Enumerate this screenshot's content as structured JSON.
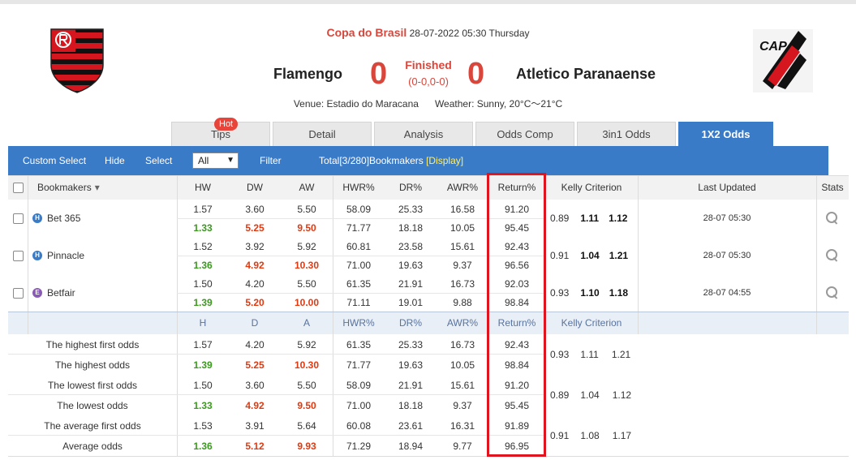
{
  "match": {
    "competition": "Copa do Brasil",
    "datetime": "28-07-2022 05:30 Thursday",
    "home_team": "Flamengo",
    "away_team": "Atletico Paranaense",
    "home_score": "0",
    "away_score": "0",
    "status": "Finished",
    "half_time": "(0-0,0-0)",
    "venue": "Venue: Estadio do Maracana",
    "weather": "Weather: Sunny, 20°C～21°C",
    "away_logo_text": "CAP"
  },
  "tabs": [
    {
      "label": "Tips",
      "badge": "Hot"
    },
    {
      "label": "Detail"
    },
    {
      "label": "Analysis"
    },
    {
      "label": "Odds Comp"
    },
    {
      "label": "3in1 Odds"
    },
    {
      "label": "1X2 Odds",
      "active": true
    }
  ],
  "toolbar": {
    "custom_select": "Custom Select",
    "hide": "Hide",
    "select": "Select",
    "dropdown_value": "All",
    "filter": "Filter",
    "total": "Total[3/280]Bookmakers",
    "display": "[Display]"
  },
  "headers": {
    "bookmakers": "Bookmakers",
    "hw": "HW",
    "dw": "DW",
    "aw": "AW",
    "hwr": "HWR%",
    "dr": "DR%",
    "awr": "AWR%",
    "ret": "Return%",
    "kelly": "Kelly Criterion",
    "updated": "Last Updated",
    "stats": "Stats"
  },
  "bookmakers": [
    {
      "name": "Bet 365",
      "icon_letter": "H",
      "icon_color": "#3a7bc8",
      "first": {
        "h": "1.57",
        "d": "3.60",
        "a": "5.50",
        "hwr": "58.09",
        "dr": "25.33",
        "awr": "16.58",
        "ret": "91.20"
      },
      "live": {
        "h": "1.33",
        "d": "5.25",
        "a": "9.50",
        "hwr": "71.77",
        "dr": "18.18",
        "awr": "10.05",
        "ret": "95.45"
      },
      "kelly": [
        "0.89",
        "1.11",
        "1.12"
      ],
      "updated": "28-07 05:30"
    },
    {
      "name": "Pinnacle",
      "icon_letter": "H",
      "icon_color": "#3a7bc8",
      "first": {
        "h": "1.52",
        "d": "3.92",
        "a": "5.92",
        "hwr": "60.81",
        "dr": "23.58",
        "awr": "15.61",
        "ret": "92.43"
      },
      "live": {
        "h": "1.36",
        "d": "4.92",
        "a": "10.30",
        "hwr": "71.00",
        "dr": "19.63",
        "awr": "9.37",
        "ret": "96.56"
      },
      "kelly": [
        "0.91",
        "1.04",
        "1.21"
      ],
      "updated": "28-07 05:30"
    },
    {
      "name": "Betfair",
      "icon_letter": "E",
      "icon_color": "#8a5bb5",
      "first": {
        "h": "1.50",
        "d": "4.20",
        "a": "5.50",
        "hwr": "61.35",
        "dr": "21.91",
        "awr": "16.73",
        "ret": "92.03"
      },
      "live": {
        "h": "1.39",
        "d": "5.20",
        "a": "10.00",
        "hwr": "71.11",
        "dr": "19.01",
        "awr": "9.88",
        "ret": "98.84"
      },
      "kelly": [
        "0.93",
        "1.10",
        "1.18"
      ],
      "updated": "28-07 04:55"
    }
  ],
  "summary_headers": {
    "h": "H",
    "d": "D",
    "a": "A",
    "hwr": "HWR%",
    "dr": "DR%",
    "awr": "AWR%",
    "ret": "Return%",
    "kelly": "Kelly Criterion"
  },
  "summary": [
    {
      "first_label": "The highest first odds",
      "first": {
        "h": "1.57",
        "d": "4.20",
        "a": "5.92",
        "hwr": "61.35",
        "dr": "25.33",
        "awr": "16.73",
        "ret": "92.43"
      },
      "live_label": "The highest odds",
      "live": {
        "h": "1.39",
        "d": "5.25",
        "a": "10.30",
        "hwr": "71.77",
        "dr": "19.63",
        "awr": "10.05",
        "ret": "98.84"
      },
      "kelly": [
        "0.93",
        "1.11",
        "1.21"
      ]
    },
    {
      "first_label": "The lowest first odds",
      "first": {
        "h": "1.50",
        "d": "3.60",
        "a": "5.50",
        "hwr": "58.09",
        "dr": "21.91",
        "awr": "15.61",
        "ret": "91.20"
      },
      "live_label": "The lowest odds",
      "live": {
        "h": "1.33",
        "d": "4.92",
        "a": "9.50",
        "hwr": "71.00",
        "dr": "18.18",
        "awr": "9.37",
        "ret": "95.45"
      },
      "kelly": [
        "0.89",
        "1.04",
        "1.12"
      ]
    },
    {
      "first_label": "The average first odds",
      "first": {
        "h": "1.53",
        "d": "3.91",
        "a": "5.64",
        "hwr": "60.08",
        "dr": "23.61",
        "awr": "16.31",
        "ret": "91.89"
      },
      "live_label": "Average odds",
      "live": {
        "h": "1.36",
        "d": "5.12",
        "a": "9.93",
        "hwr": "71.29",
        "dr": "18.94",
        "awr": "9.77",
        "ret": "96.95"
      },
      "kelly": [
        "0.91",
        "1.08",
        "1.17"
      ]
    }
  ],
  "colors": {
    "accent_blue": "#3a7bc8",
    "score_red": "#d9463b",
    "odds_green": "#3a9a1e",
    "odds_red": "#e03a12",
    "highlight": "#e0141e"
  }
}
